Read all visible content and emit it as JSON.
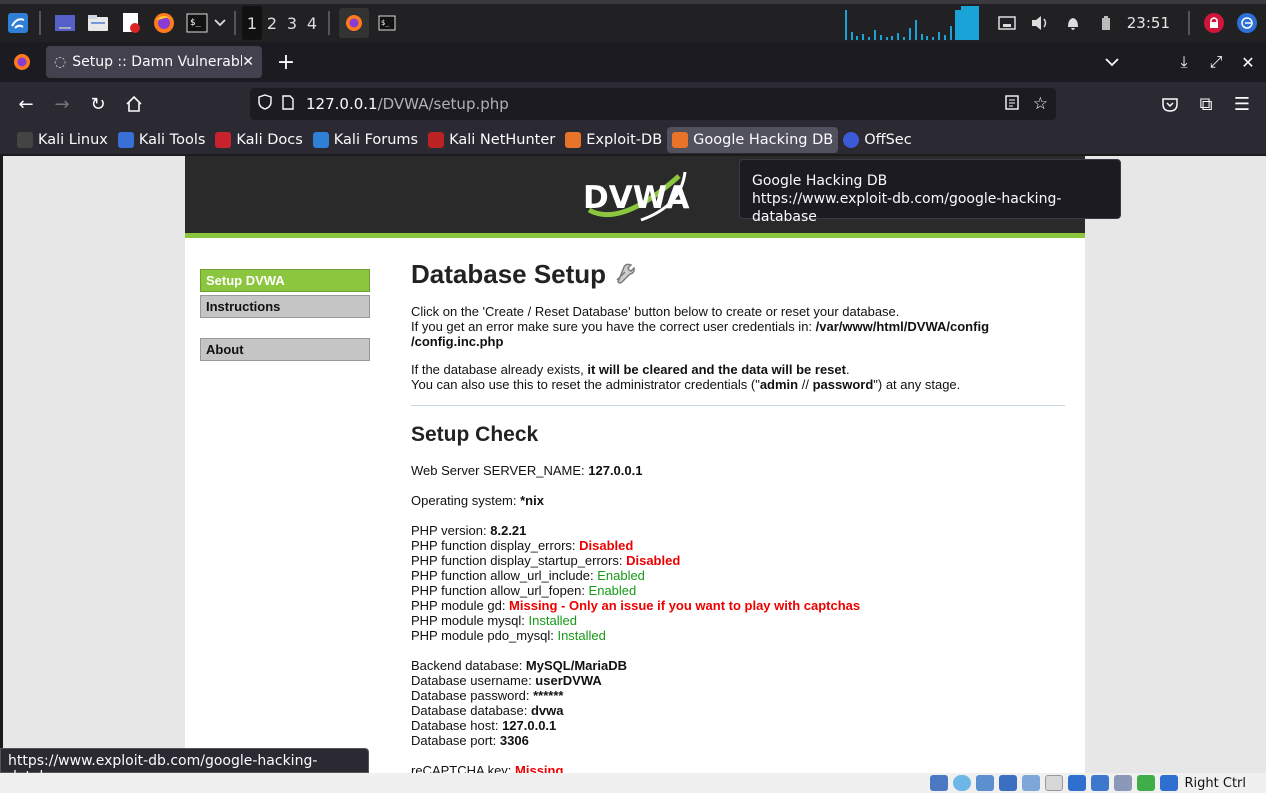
{
  "panel": {
    "workspaces": [
      "1",
      "2",
      "3",
      "4"
    ],
    "clock": "23:51",
    "icons": [
      "kali-menu-icon",
      "show-desktop-icon",
      "file-manager-icon",
      "text-editor-icon",
      "firefox-icon",
      "terminal-icon"
    ]
  },
  "browser": {
    "tab_title": "Setup :: Damn Vulnerable",
    "url_host": "127.0.0.1",
    "url_path": "/DVWA/setup.php",
    "bookmarks": [
      "Kali Linux",
      "Kali Tools",
      "Kali Docs",
      "Kali Forums",
      "Kali NetHunter",
      "Exploit-DB",
      "Google Hacking DB",
      "OffSec"
    ],
    "tooltip_title": "Google Hacking DB",
    "tooltip_url": "https://www.exploit-db.com/google-hacking-database",
    "status_url": "https://www.exploit-db.com/google-hacking-database"
  },
  "dvwa": {
    "logo_text": "DVWA",
    "menu": {
      "setup": "Setup DVWA",
      "instructions": "Instructions",
      "about": "About"
    },
    "title": "Database Setup",
    "intro1": "Click on the 'Create / Reset Database' button below to create or reset your database.",
    "intro2": "If you get an error make sure you have the correct user credentials in: ",
    "config_path_1": "/var/www/html/DVWA/config",
    "config_path_2": "/config.inc.php",
    "exists1": "If the database already exists, ",
    "exists1_bold": "it will be cleared and the data will be reset",
    "exists1_end": ".",
    "exists2a": "You can also use this to reset the administrator credentials (\"",
    "exists2_admin": "admin",
    "exists2_sep": " // ",
    "exists2_pwd": "password",
    "exists2_end": "\") at any stage.",
    "check_title": "Setup Check",
    "server_label": "Web Server SERVER_NAME: ",
    "server_val": "127.0.0.1",
    "os_label": "Operating system: ",
    "os_val": "*nix",
    "php_version_label": "PHP version: ",
    "php_version_val": "8.2.21",
    "php1_label": "PHP function display_errors: ",
    "php1_val": "Disabled",
    "php2_label": "PHP function display_startup_errors: ",
    "php2_val": "Disabled",
    "php3_label": "PHP function allow_url_include: ",
    "php3_val": "Enabled",
    "php4_label": "PHP function allow_url_fopen: ",
    "php4_val": "Enabled",
    "php5_label": "PHP module gd: ",
    "php5_val": "Missing - Only an issue if you want to play with captchas",
    "php6_label": "PHP module mysql: ",
    "php6_val": "Installed",
    "php7_label": "PHP module pdo_mysql: ",
    "php7_val": "Installed",
    "db1_label": "Backend database: ",
    "db1_val": "MySQL/MariaDB",
    "db2_label": "Database username: ",
    "db2_val": "userDVWA",
    "db3_label": "Database password: ",
    "db3_val": "******",
    "db4_label": "Database database: ",
    "db4_val": "dvwa",
    "db5_label": "Database host: ",
    "db5_val": "127.0.0.1",
    "db6_label": "Database port: ",
    "db6_val": "3306",
    "recaptcha_label": "reCAPTCHA key: ",
    "recaptcha_val": "Missing"
  },
  "vbox": {
    "host_key": "Right Ctrl"
  },
  "colors": {
    "dvwa_green": "#8cc63f",
    "error_red": "#e00000",
    "ok_green": "#169b16"
  }
}
